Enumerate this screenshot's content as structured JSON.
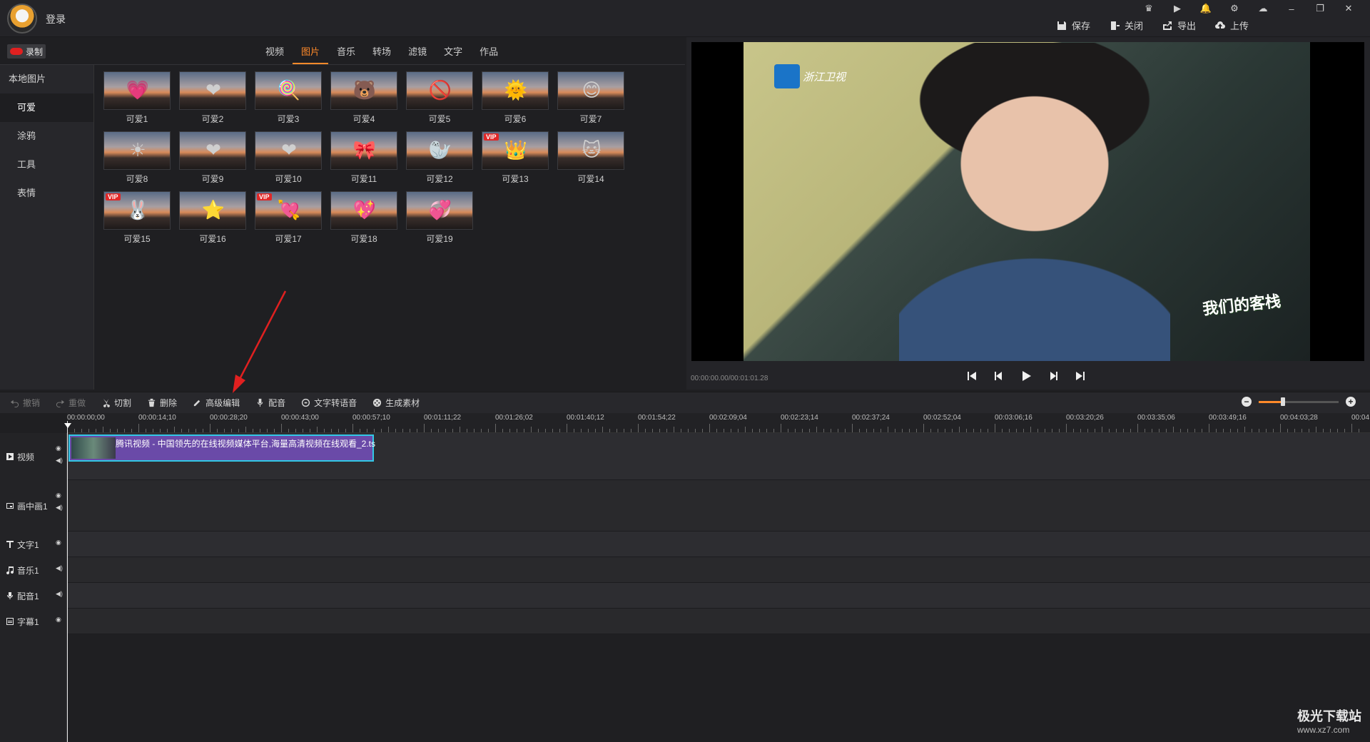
{
  "titlebar": {
    "login": "登录",
    "toolbar": [
      {
        "label": "保存",
        "icon": "save-icon"
      },
      {
        "label": "关闭",
        "icon": "close-file-icon"
      },
      {
        "label": "导出",
        "icon": "export-icon"
      },
      {
        "label": "上传",
        "icon": "upload-icon"
      }
    ],
    "win_controls": [
      "VIP",
      "▶",
      "🔔",
      "⚙",
      "⌂",
      "–",
      "❐",
      "✕"
    ]
  },
  "record_label": "录制",
  "tabs": [
    "视频",
    "图片",
    "音乐",
    "转场",
    "滤镜",
    "文字",
    "作品"
  ],
  "active_tab": "图片",
  "sidebar": {
    "heading": "本地图片",
    "items": [
      "可爱",
      "涂鸦",
      "工具",
      "表情"
    ],
    "active": "可爱"
  },
  "stickers": [
    {
      "label": "可爱1",
      "glyph": "💗",
      "vip": false
    },
    {
      "label": "可爱2",
      "glyph": "❤",
      "vip": false
    },
    {
      "label": "可爱3",
      "glyph": "🍭",
      "vip": false
    },
    {
      "label": "可爱4",
      "glyph": "🐻",
      "vip": false
    },
    {
      "label": "可爱5",
      "glyph": "🚫",
      "vip": false
    },
    {
      "label": "可爱6",
      "glyph": "🌞",
      "vip": false
    },
    {
      "label": "可爱7",
      "glyph": "😊",
      "vip": false
    },
    {
      "label": "可爱8",
      "glyph": "☀",
      "vip": false
    },
    {
      "label": "可爱9",
      "glyph": "❤",
      "vip": false
    },
    {
      "label": "可爱10",
      "glyph": "❤",
      "vip": false
    },
    {
      "label": "可爱11",
      "glyph": "🎀",
      "vip": false
    },
    {
      "label": "可爱12",
      "glyph": "🦭",
      "vip": false
    },
    {
      "label": "可爱13",
      "glyph": "👑",
      "vip": true
    },
    {
      "label": "可爱14",
      "glyph": "🐱",
      "vip": false
    },
    {
      "label": "可爱15",
      "glyph": "🐰",
      "vip": true
    },
    {
      "label": "可爱16",
      "glyph": "⭐",
      "vip": false
    },
    {
      "label": "可爱17",
      "glyph": "💘",
      "vip": true
    },
    {
      "label": "可爱18",
      "glyph": "💖",
      "vip": false
    },
    {
      "label": "可爱19",
      "glyph": "💞",
      "vip": false
    }
  ],
  "vip_text": "VIP",
  "preview": {
    "channel": "浙江卫视",
    "show_title": "我们的客栈",
    "timecode": "00:00:00.00/00:01:01.28"
  },
  "edit_toolbar": [
    {
      "label": "撤销",
      "icon": "undo-icon",
      "enabled": false
    },
    {
      "label": "重做",
      "icon": "redo-icon",
      "enabled": false
    },
    {
      "label": "切割",
      "icon": "scissors-icon",
      "enabled": true
    },
    {
      "label": "删除",
      "icon": "trash-icon",
      "enabled": true
    },
    {
      "label": "高级编辑",
      "icon": "pencil-icon",
      "enabled": true
    },
    {
      "label": "配音",
      "icon": "microphone-icon",
      "enabled": true
    },
    {
      "label": "文字转语音",
      "icon": "speech-icon",
      "enabled": true
    },
    {
      "label": "生成素材",
      "icon": "film-reel-icon",
      "enabled": true
    }
  ],
  "zoom_level": 0.3,
  "ruler": [
    "00:00:00;00",
    "00:00:14;10",
    "00:00:28;20",
    "00:00:43;00",
    "00:00:57;10",
    "00:01:11;22",
    "00:01:26;02",
    "00:01:40;12",
    "00:01:54;22",
    "00:02:09;04",
    "00:02:23;14",
    "00:02:37;24",
    "00:02:52;04",
    "00:03:06;16",
    "00:03:20;26",
    "00:03:35;06",
    "00:03:49;16",
    "00:04:03;28",
    "00:04"
  ],
  "tracks": [
    {
      "label": "视频",
      "icon": "play-box-icon",
      "eye": true,
      "sound": true
    },
    {
      "label": "画中画1",
      "icon": "pip-icon",
      "eye": true,
      "sound": true
    },
    {
      "label": "文字1",
      "icon": "text-icon",
      "eye": true,
      "sound": false
    },
    {
      "label": "音乐1",
      "icon": "music-note-icon",
      "eye": false,
      "sound": true
    },
    {
      "label": "配音1",
      "icon": "microphone-icon",
      "eye": false,
      "sound": true
    },
    {
      "label": "字幕1",
      "icon": "subtitle-icon",
      "eye": true,
      "sound": false
    }
  ],
  "clip_title": "腾讯视频 - 中国领先的在线视频媒体平台,海量高清视频在线观看_2.ts",
  "watermark": {
    "title": "极光下载站",
    "url": "www.xz7.com"
  }
}
